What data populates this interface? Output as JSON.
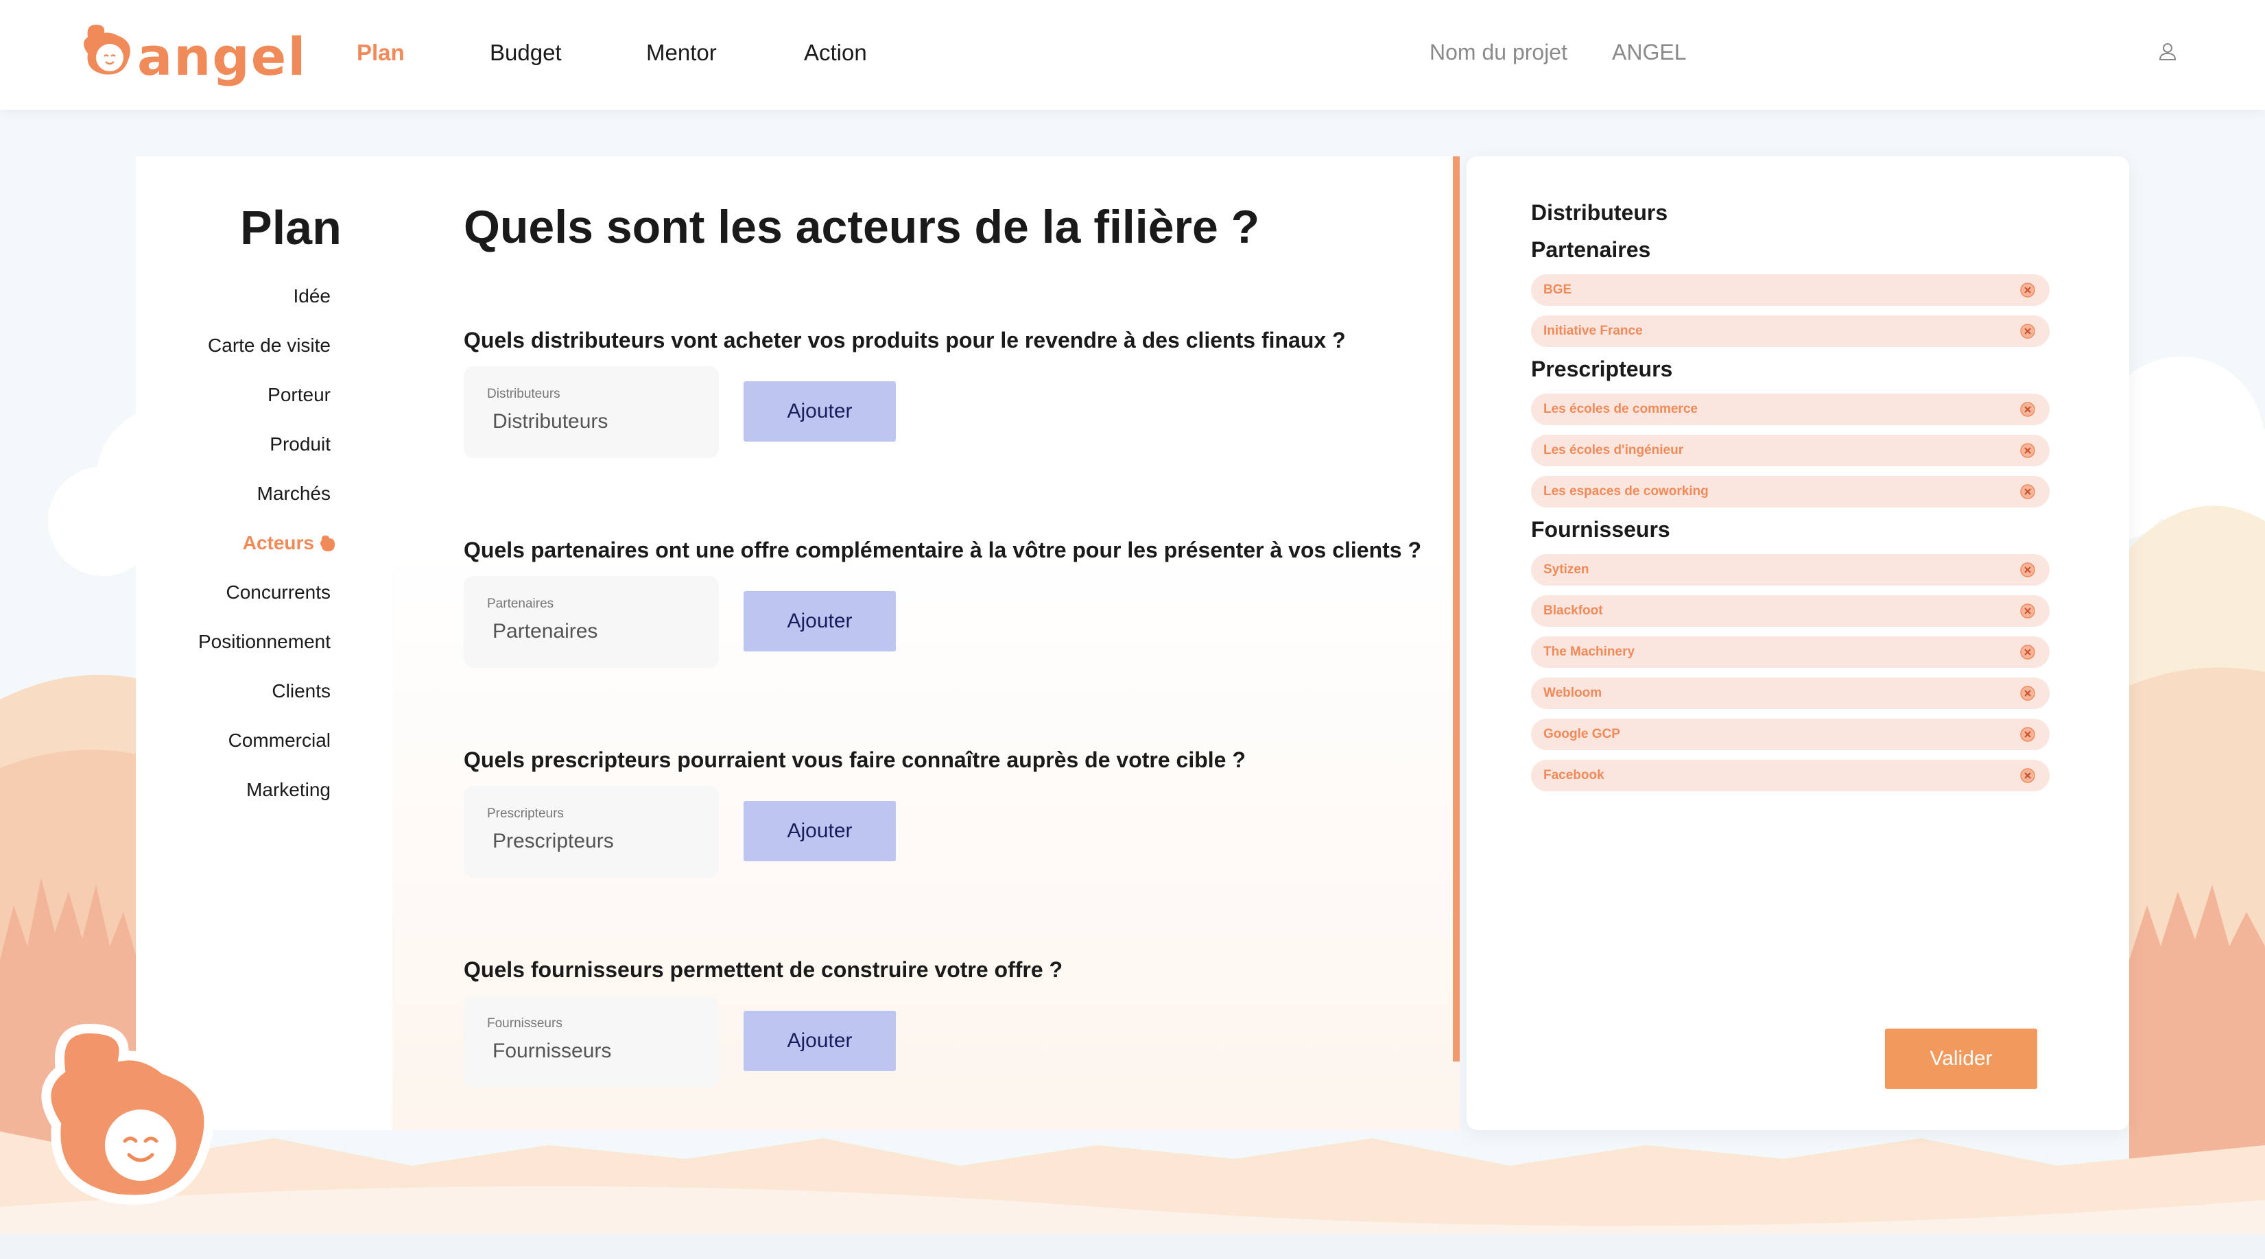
{
  "header": {
    "logo_text": "angel",
    "nav": [
      "Plan",
      "Budget",
      "Mentor",
      "Action"
    ],
    "active_nav": "Plan",
    "project_label": "Nom du projet",
    "project_name": "ANGEL"
  },
  "sidebar": {
    "title": "Plan",
    "items": [
      "Idée",
      "Carte de visite",
      "Porteur",
      "Produit",
      "Marchés",
      "Acteurs",
      "Concurrents",
      "Positionnement",
      "Clients",
      "Commercial",
      "Marketing"
    ],
    "active": "Acteurs"
  },
  "main": {
    "title": "Quels sont les acteurs de la filière ?",
    "add_label": "Ajouter",
    "questions": [
      {
        "label": "Quels distributeurs vont acheter vos produits pour le revendre à des clients finaux ?",
        "field_label": "Distributeurs",
        "placeholder": "Distributeurs"
      },
      {
        "label": "Quels partenaires ont une offre complémentaire à la vôtre pour les présenter à vos clients ?",
        "field_label": "Partenaires",
        "placeholder": "Partenaires"
      },
      {
        "label": "Quels prescripteurs pourraient vous faire connaître auprès de votre cible ?",
        "field_label": "Prescripteurs",
        "placeholder": "Prescripteurs"
      },
      {
        "label": "Quels fournisseurs permettent de construire votre offre ?",
        "field_label": "Fournisseurs",
        "placeholder": "Fournisseurs"
      }
    ]
  },
  "summary": {
    "groups": [
      {
        "title": "Distributeurs",
        "items": []
      },
      {
        "title": "Partenaires",
        "items": [
          "BGE",
          "Initiative France"
        ]
      },
      {
        "title": "Prescripteurs",
        "items": [
          "Les écoles de commerce",
          "Les écoles d'ingénieur",
          "Les espaces de coworking"
        ]
      },
      {
        "title": "Fournisseurs",
        "items": [
          "Sytizen",
          "Blackfoot",
          "The Machinery",
          "Webloom",
          "Google GCP",
          "Facebook"
        ]
      }
    ],
    "validate_label": "Valider"
  },
  "colors": {
    "accent": "#f08a58",
    "button_blue": "#bcc6f0",
    "chip_bg": "#fbe5df"
  }
}
